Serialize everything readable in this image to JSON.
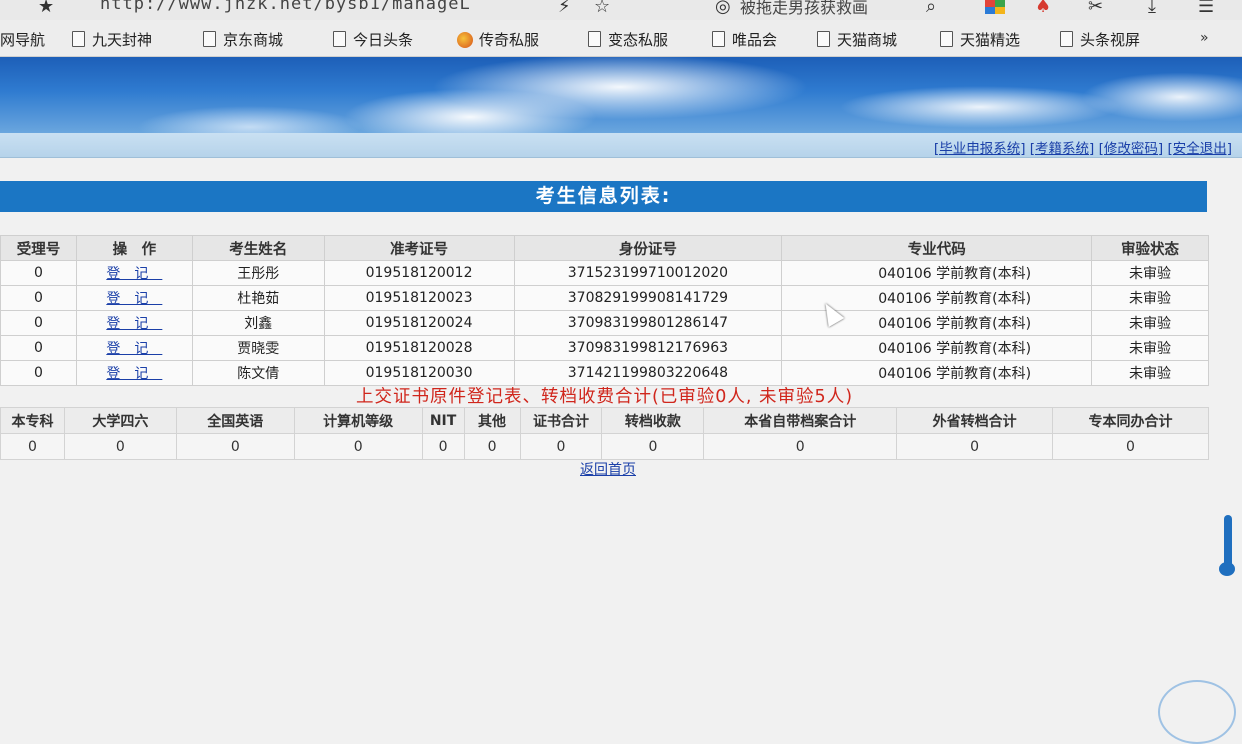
{
  "browser": {
    "url": "http://www.jnzk.net/bysb1/manageL",
    "search_text": "被拖走男孩获救画",
    "bookmarks": [
      "网导航",
      "九天封神",
      "京东商城",
      "今日头条",
      "传奇私服",
      "变态私服",
      "唯品会",
      "天猫商城",
      "天猫精选",
      "头条视屏"
    ],
    "more_label": "»"
  },
  "header_links": [
    "[毕业申报系统]",
    "[考籍系统]",
    "[修改密码]",
    "[安全退出]"
  ],
  "title": "考生信息列表:",
  "table": {
    "columns": [
      "受理号",
      "操　作",
      "考生姓名",
      "准考证号",
      "身份证号",
      "专业代码",
      "审验状态"
    ],
    "rows": [
      {
        "no": "0",
        "action": "登记",
        "name": "王彤彤",
        "exam_id": "019518120012",
        "id_card": "371523199710012020",
        "major": "040106 学前教育(本科)",
        "status": "未审验"
      },
      {
        "no": "0",
        "action": "登记",
        "name": "杜艳茹",
        "exam_id": "019518120023",
        "id_card": "370829199908141729",
        "major": "040106 学前教育(本科)",
        "status": "未审验"
      },
      {
        "no": "0",
        "action": "登记",
        "name": "刘鑫",
        "exam_id": "019518120024",
        "id_card": "370983199801286147",
        "major": "040106 学前教育(本科)",
        "status": "未审验"
      },
      {
        "no": "0",
        "action": "登记",
        "name": "贾晓雯",
        "exam_id": "019518120028",
        "id_card": "370983199812176963",
        "major": "040106 学前教育(本科)",
        "status": "未审验"
      },
      {
        "no": "0",
        "action": "登记",
        "name": "陈文倩",
        "exam_id": "019518120030",
        "id_card": "371421199803220648",
        "major": "040106 学前教育(本科)",
        "status": "未审验"
      }
    ]
  },
  "summary": {
    "title": "上交证书原件登记表、转档收费合计(已审验0人, 未审验5人)",
    "columns": [
      "本专科",
      "大学四六",
      "全国英语",
      "计算机等级",
      "NIT",
      "其他",
      "证书合计",
      "转档收款",
      "本省自带档案合计",
      "外省转档合计",
      "专本同办合计"
    ],
    "values": [
      "0",
      "0",
      "0",
      "0",
      "0",
      "0",
      "0",
      "0",
      "0",
      "0",
      "0"
    ]
  },
  "back_home": "返回首页",
  "colors": {
    "title_bar": "#1b76c4",
    "summary_title": "#d0261c",
    "link": "#1a3fa8"
  }
}
